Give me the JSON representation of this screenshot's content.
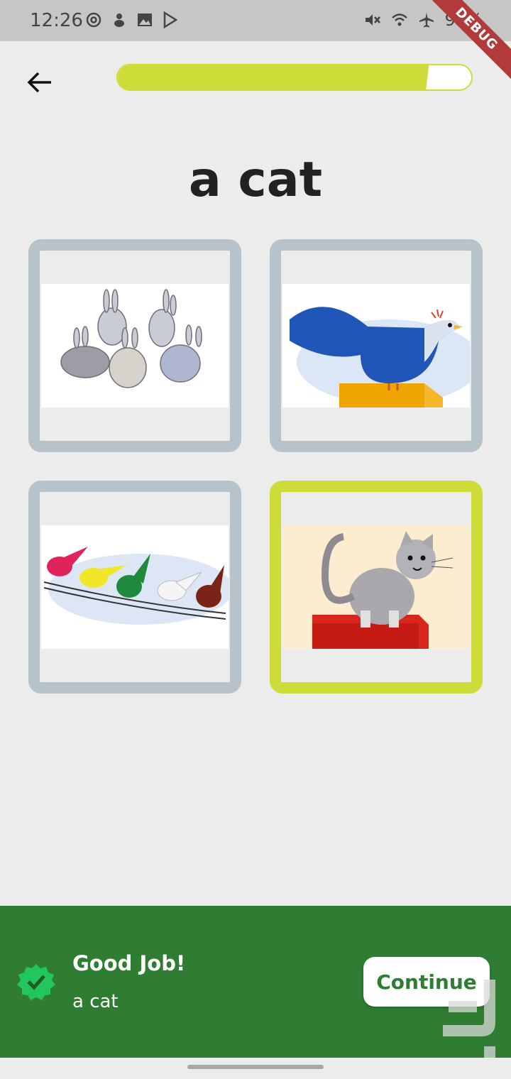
{
  "status_bar": {
    "time": "12:26",
    "battery": "98%",
    "left_icons": [
      "at-sign-icon",
      "notification-icon",
      "image-icon",
      "play-store-icon"
    ],
    "right_icons": [
      "mute-icon",
      "wifi-icon",
      "airplane-icon",
      "battery-icon"
    ],
    "debug_label": "DEBUG"
  },
  "header": {
    "back_icon": "arrow-left-icon",
    "progress_fraction": 0.88
  },
  "prompt": {
    "word": "a cat"
  },
  "options": [
    {
      "image": "rabbits",
      "selected": false
    },
    {
      "image": "blue-bird",
      "selected": false
    },
    {
      "image": "birds-on-wire",
      "selected": false
    },
    {
      "image": "cat",
      "selected": true
    }
  ],
  "feedback": {
    "title": "Good Job!",
    "answer": "a cat",
    "continue_label": "Continue",
    "icon": "check-badge-icon"
  },
  "colors": {
    "accent": "#cddc39",
    "card_border": "#b7c3ca",
    "success_panel": "#2e7d32",
    "background": "#ececec"
  }
}
